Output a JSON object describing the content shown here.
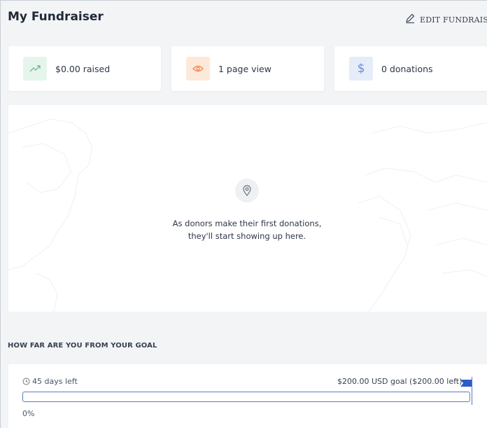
{
  "header": {
    "title": "My Fundraiser",
    "edit_label": "EDIT FUNDRAISER"
  },
  "stats": [
    {
      "label": "$0.00 raised",
      "icon": "trending-up-icon",
      "color": "#6fbf8f",
      "bg": "#e6f5ec"
    },
    {
      "label": "1 page view",
      "icon": "eye-icon",
      "color": "#f08a4b",
      "bg": "#fde9da"
    },
    {
      "label": "0 donations",
      "icon": "dollar-icon",
      "color": "#6b8ed6",
      "bg": "#e6ecf8"
    }
  ],
  "map": {
    "message_line1": "As donors make their first donations,",
    "message_line2": "they'll start showing up here."
  },
  "goal": {
    "heading": "HOW FAR ARE YOU FROM YOUR GOAL",
    "days_left": "45 days left",
    "goal_text": "$200.00 USD goal ($200.00 left)",
    "progress_label": "0%",
    "progress_fraction": 0,
    "accent": "#5a7bc8"
  }
}
